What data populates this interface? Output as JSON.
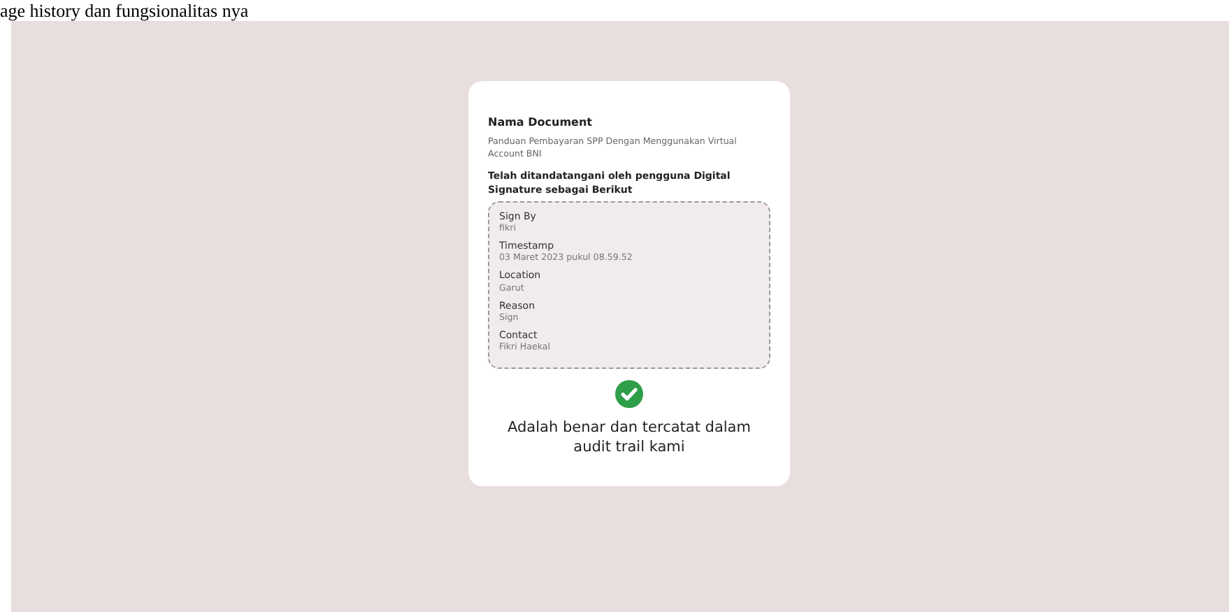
{
  "document_caption": "age history dan fungsionalitas nya",
  "card": {
    "title": "Nama Document",
    "document_name": "Panduan Pembayaran SPP Dengan Menggunakan Virtual Account BNI",
    "signed_heading": "Telah ditandatangani oleh pengguna Digital Signature sebagai Berikut",
    "fields": [
      {
        "label": "Sign By",
        "value": "fikri"
      },
      {
        "label": "Timestamp",
        "value": "03 Maret 2023 pukul 08.59.52"
      },
      {
        "label": "Location",
        "value": "Garut"
      },
      {
        "label": "Reason",
        "value": "Sign"
      },
      {
        "label": "Contact",
        "value": "Fikri Haekal"
      }
    ],
    "verified": true,
    "message": "Adalah benar dan tercatat dalam audit trail kami"
  }
}
